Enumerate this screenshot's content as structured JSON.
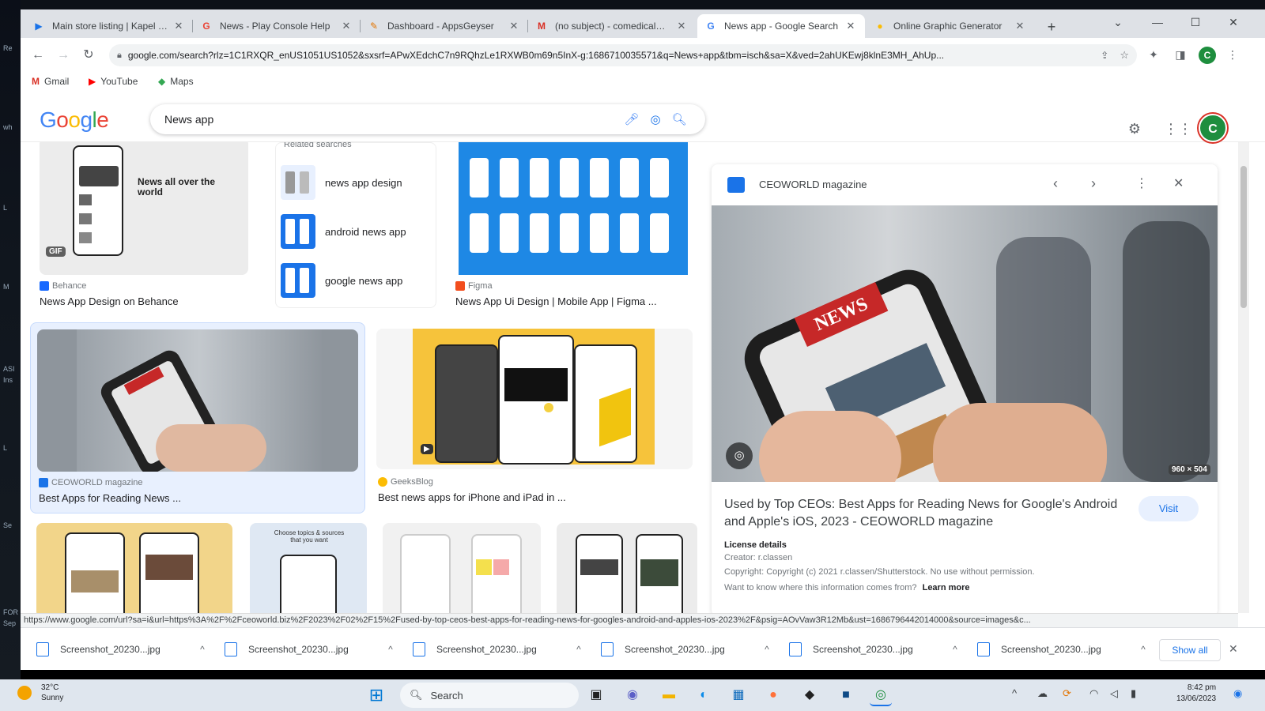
{
  "desktop": {
    "labels": [
      "Re",
      "wh",
      "L",
      "M",
      "ASI",
      "Ins",
      "L",
      "Se",
      "FOR",
      "Sep"
    ]
  },
  "browser": {
    "tabs": [
      {
        "label": "Main store listing | Kapel U...",
        "icon": "play-console-icon",
        "color": "#1a73e8",
        "glyph": "▶"
      },
      {
        "label": "News - Play Console Help",
        "icon": "google-icon",
        "color": "#ea4335",
        "glyph": "G"
      },
      {
        "label": "Dashboard - AppsGeyser",
        "icon": "appsgeyser-icon",
        "color": "#e37400",
        "glyph": "✎"
      },
      {
        "label": "(no subject) - comedicalap...",
        "icon": "gmail-icon",
        "color": "#d93025",
        "glyph": "M"
      },
      {
        "label": "News app - Google Search",
        "icon": "google-icon",
        "color": "#4285f4",
        "glyph": "G",
        "active": true
      },
      {
        "label": "Online Graphic Generator",
        "icon": "generator-icon",
        "color": "#fbbc04",
        "glyph": "●"
      }
    ],
    "new_tab": "+",
    "url": "google.com/search?rlz=1C1RXQR_enUS1051US1052&sxsrf=APwXEdchC7n9RQhzLe1RXWB0m69n5InX-g:1686710035571&q=News+app&tbm=isch&sa=X&ved=2ahUKEwj8klnE3MH_AhUp...",
    "bookmarks": [
      {
        "label": "Gmail",
        "glyph": "M",
        "color": "#d93025"
      },
      {
        "label": "YouTube",
        "glyph": "▶",
        "color": "#ff0000"
      },
      {
        "label": "Maps",
        "glyph": "◆",
        "color": "#34a853"
      }
    ],
    "profile_initial": "C",
    "status_url": "https://www.google.com/url?sa=i&url=https%3A%2F%2Fceoworld.biz%2F2023%2F02%2F15%2Fused-by-top-ceos-best-apps-for-reading-news-for-googles-android-and-apples-ios-2023%2F&psig=AOvVaw3R12Mb&ust=1686796442014000&source=images&c..."
  },
  "google": {
    "logo": "Google",
    "query": "News app",
    "avatar_initial": "C"
  },
  "results": {
    "row1": [
      {
        "source": "Behance",
        "title": "News App Design on Behance",
        "overlay_text": "News all over the world",
        "gif_badge": "GIF"
      },
      {
        "source": "Figma",
        "title": "News App Ui Design | Mobile App | Figma ..."
      }
    ],
    "related": {
      "heading": "Related searches",
      "items": [
        "news app design",
        "android news app",
        "google news app"
      ]
    },
    "row2": [
      {
        "source": "CEOWORLD magazine",
        "title": "Best Apps for Reading News ..."
      },
      {
        "source": "GeeksBlog",
        "title": "Best news apps for iPhone and iPad in ..."
      }
    ]
  },
  "panel": {
    "source": "CEOWORLD magazine",
    "dimensions": "960 × 504",
    "news_text": "NEWS",
    "title": "Used by Top CEOs: Best Apps for Reading News for Google's Android and Apple's iOS, 2023 - CEOWORLD magazine",
    "visit": "Visit",
    "license_heading": "License details",
    "creator": "Creator: r.classen",
    "copyright": "Copyright: Copyright (c) 2021 r.classen/Shutterstock. No use without permission.",
    "learn_prefix": "Want to know where this information comes from?",
    "learn_more": "Learn more"
  },
  "downloads": {
    "items": [
      "Screenshot_20230...jpg",
      "Screenshot_20230...jpg",
      "Screenshot_20230...jpg",
      "Screenshot_20230...jpg",
      "Screenshot_20230...jpg",
      "Screenshot_20230...jpg"
    ],
    "show_all": "Show all"
  },
  "taskbar": {
    "temp": "32°C",
    "weather": "Sunny",
    "search": "Search",
    "time": "8:42 pm",
    "date": "13/06/2023"
  }
}
